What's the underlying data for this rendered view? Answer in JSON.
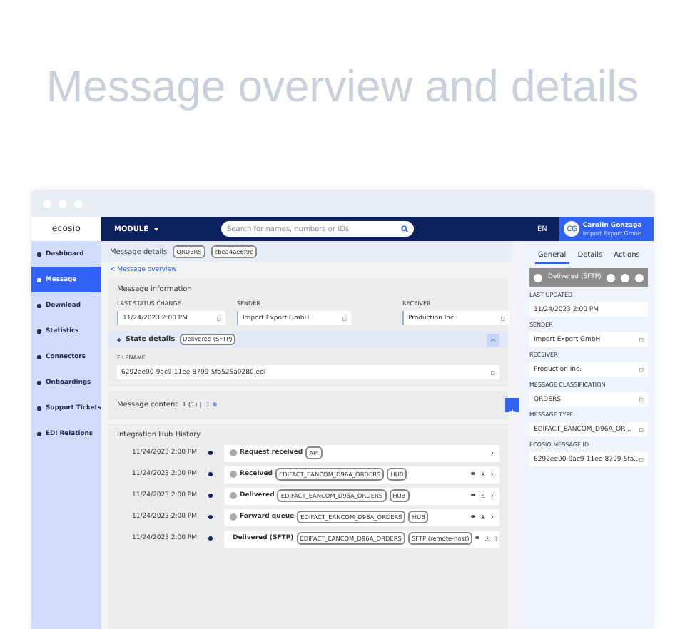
{
  "headline": "Message overview and details",
  "logo": "ecosio",
  "sidebar": {
    "items": [
      {
        "label": "Dashboard",
        "selected": false
      },
      {
        "label": "Message",
        "selected": true
      },
      {
        "label": "Download",
        "selected": false
      },
      {
        "label": "Statistics",
        "selected": false
      },
      {
        "label": "Connectors",
        "selected": false
      },
      {
        "label": "Onboardings",
        "selected": false
      },
      {
        "label": "Support Tickets",
        "selected": false
      },
      {
        "label": "EDI Relations",
        "selected": false
      }
    ]
  },
  "topbar": {
    "module": "MODULE",
    "search": {
      "placeholder": "Search for names, numbers or IDs"
    },
    "language": "EN",
    "user": {
      "initials": "CG",
      "name": "Carolin Gonzaga",
      "company": "Import Export GmbH"
    }
  },
  "details_bar": {
    "title": "Message details",
    "chips": [
      "ORDERS",
      "cbea4ae6f9e"
    ]
  },
  "breadcrumb": "< Message overview",
  "message_information": {
    "title": "Message information",
    "fields": [
      {
        "label": "LAST STATUS CHANGE",
        "value": "11/24/2023 2:00 PM"
      },
      {
        "label": "SENDER",
        "value": "Import Export GmbH"
      },
      {
        "label": "RECEIVER",
        "value": "Production Inc."
      }
    ],
    "state_details": {
      "title": "State details",
      "chip": "Delivered (SFTP)",
      "expanded": true,
      "file_label": "FILENAME",
      "file_value": "6292ee00-9ac9-11ee-8799-5fa525a0280.edi"
    }
  },
  "message_content": {
    "title": "Message content",
    "count": "1 (1) |",
    "link": "1 ⊕"
  },
  "history": {
    "title": "Integration Hub History",
    "rows": [
      {
        "time": "11/24/2023 2:00 PM",
        "event": "Request received",
        "chips": [
          "API"
        ],
        "actions": false
      },
      {
        "time": "11/24/2023 2:00 PM",
        "event": "Received",
        "chips": [
          "EDIFACT_EANCOM_D96A_ORDERS",
          "HUB"
        ],
        "actions": true
      },
      {
        "time": "11/24/2023 2:00 PM",
        "event": "Delivered",
        "chips": [
          "EDIFACT_EANCOM_D96A_ORDERS",
          "HUB"
        ],
        "actions": true
      },
      {
        "time": "11/24/2023 2:00 PM",
        "event": "Forward queue",
        "chips": [
          "EDIFACT_EANCOM_D96A_ORDERS",
          "HUB"
        ],
        "actions": true
      },
      {
        "time": "11/24/2023 2:00 PM",
        "event": "Delivered (SFTP)",
        "chips": [
          "EDIFACT_EANCOM_D96A_ORDERS",
          "SFTP (remote-host)"
        ],
        "actions": true
      }
    ]
  },
  "panel": {
    "tabs": [
      {
        "label": "General",
        "selected": true
      },
      {
        "label": "Details",
        "selected": false
      },
      {
        "label": "Actions",
        "selected": false
      }
    ],
    "status": "Delivered (SFTP)",
    "fields": [
      {
        "label": "LAST UPDATED",
        "value": "11/24/2023 2:00 PM",
        "copy": false
      },
      {
        "label": "SENDER",
        "value": "Import Export GmbH",
        "copy": true
      },
      {
        "label": "RECEIVER",
        "value": "Production Inc.",
        "copy": true
      },
      {
        "label": "MESSAGE CLASSIFICATION",
        "value": "ORDERS",
        "copy": true
      },
      {
        "label": "MESSAGE TYPE",
        "value": "EDIFACT_EANCOM_D96A_OR...",
        "copy": true
      },
      {
        "label": "ECOSIO MESSAGE ID",
        "value": "6292ee00-9ac9-11ee-8799-5fa...",
        "copy": true
      }
    ]
  }
}
